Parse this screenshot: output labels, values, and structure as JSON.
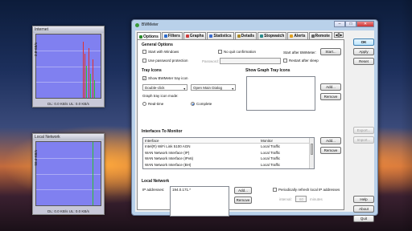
{
  "gadgets": {
    "internet": {
      "title": "Internet",
      "ylabel": "2.8 KB/s",
      "footer": "DL: 0.0 KB/s    UL: 0.0 KB/s"
    },
    "local": {
      "title": "Local Network",
      "ylabel": "56.4 KB/s",
      "footer": "DL: 0.0 KB/s    UL: 0.0 KB/s"
    }
  },
  "window": {
    "title": "BWMeter",
    "controls": {
      "minimize": "–",
      "maximize": "□",
      "close": "✕"
    }
  },
  "tabs": [
    {
      "label": "Options",
      "icon": "options-icon",
      "color": "#2a8a2a"
    },
    {
      "label": "Filters",
      "icon": "filters-icon",
      "color": "#2a6acc"
    },
    {
      "label": "Graphs",
      "icon": "graphs-icon",
      "color": "#cc3a3a"
    },
    {
      "label": "Statistics",
      "icon": "statistics-icon",
      "color": "#3a6acc"
    },
    {
      "label": "Details",
      "icon": "details-icon",
      "color": "#aa8a2a"
    },
    {
      "label": "Stopwatch",
      "icon": "stopwatch-icon",
      "color": "#2a8a8a"
    },
    {
      "label": "Alerts",
      "icon": "alerts-icon",
      "color": "#e0a020"
    },
    {
      "label": "Remote",
      "icon": "remote-icon",
      "color": "#666"
    }
  ],
  "tab_arrows": {
    "left": "◀",
    "right": "▶"
  },
  "general": {
    "heading": "General Options",
    "start_with_windows": "Start with Windows",
    "no_quit_confirm": "No quit confirmation",
    "use_password": "Use password protection",
    "password_label": "Password:",
    "start_after_label": "Start after BWMeter:",
    "start_button": "Start...",
    "restart_after_sleep": "Restart after sleep"
  },
  "tray": {
    "heading": "Tray Icons",
    "show_icon": "Show BWMeter tray icon",
    "click_select": "Double-click",
    "action_select": "Open Main Dialog",
    "mode_label": "Graph tray icon mode:",
    "realtime": "Real-time",
    "complete": "Complete",
    "graph_heading": "Show Graph Tray Icons",
    "add": "Add...",
    "remove": "Remove"
  },
  "interfaces": {
    "heading": "Interfaces To Monitor",
    "columns": [
      "Interface",
      "Monitor"
    ],
    "rows": [
      [
        "Intel(R) WiFi Link 5100 AGN",
        "Local Traffic"
      ],
      [
        "WAN Network Interface (IP)",
        "Local Traffic"
      ],
      [
        "WAN Network Interface (IPv6)",
        "Local Traffic"
      ],
      [
        "WAN Network Interface (BH)",
        "Local Traffic"
      ]
    ],
    "add": "Add...",
    "remove": "Remove"
  },
  "local": {
    "heading": "Local Network",
    "ip_label": "IP addresses:",
    "ip_value": "194.0.171.*",
    "add": "Add...",
    "remove": "Remove",
    "periodic": "Periodically refresh local IP addresses",
    "interval_label": "interval:",
    "interval_value": "60",
    "minutes": "minutes"
  },
  "side_buttons": {
    "ok": "OK",
    "apply": "Apply",
    "reset": "Reset",
    "export": "Export...",
    "import": "Import...",
    "help": "Help",
    "about": "About",
    "quit": "Quit"
  }
}
